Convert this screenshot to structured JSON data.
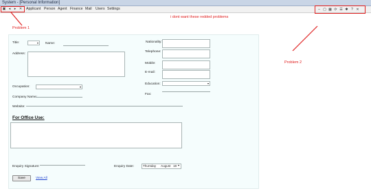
{
  "window": {
    "title": "System - [Personal Information]",
    "menu": [
      "Applicant",
      "Person",
      "Agent",
      "Finance",
      "Mail",
      "Users",
      "Settings"
    ]
  },
  "toolbar_left_icons": [
    "app-icon",
    "back-icon",
    "forward-icon",
    "close-icon"
  ],
  "toolbar_right_icons": [
    "minimize-icon",
    "restore-icon",
    "grid-icon",
    "refresh-icon",
    "list-icon",
    "settings-icon",
    "help-icon",
    "close-icon"
  ],
  "annotations": {
    "problem1": "Problem 1",
    "problem2": "Problem 2",
    "note": "i dont want these redded problems",
    "color": "#e02020"
  },
  "form": {
    "title_label": "Title:",
    "name_label": "Name:",
    "address_label": "Address:",
    "occupation_label": "Occupation:",
    "company_label": "Company Name:",
    "website_label": "Website:",
    "nationality_label": "Nationality:",
    "telephone_label": "Telephone:",
    "mobile_label": "Mobile:",
    "email_label": "E-mail:",
    "education_label": "Education:",
    "fax_label": "Fax:",
    "office_use_heading": "For Office Use:",
    "enquiry_signature_label": "Enquiry Signature:",
    "enquiry_date_label": "Enquiry Date:",
    "enquiry_date_day": "Thursday",
    "enquiry_date_month": "August",
    "enquiry_date_num": "18",
    "save_label": "Save",
    "view_all_label": "View All"
  }
}
